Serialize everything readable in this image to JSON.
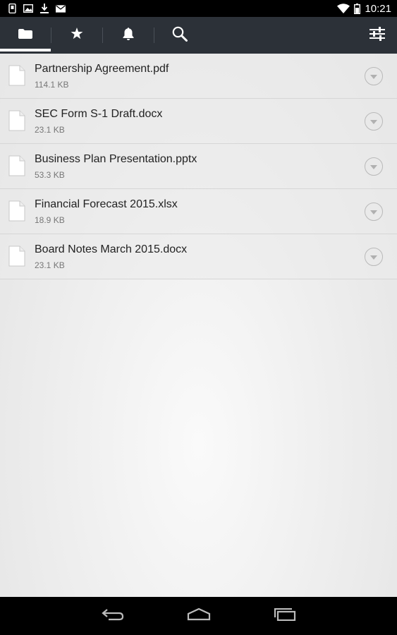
{
  "status_bar": {
    "time": "10:21",
    "left_icons": [
      "phone-storage-icon",
      "image-icon",
      "download-icon",
      "mail-icon"
    ],
    "right_icons": [
      "wifi-icon",
      "battery-icon"
    ]
  },
  "toolbar": {
    "tabs": [
      {
        "name": "folder-icon",
        "active": true
      },
      {
        "name": "star-icon",
        "active": false
      },
      {
        "name": "bell-icon",
        "active": false
      },
      {
        "name": "search-icon",
        "active": false
      }
    ],
    "settings_icon": "sliders-icon",
    "background": "#2c3138"
  },
  "files": [
    {
      "name": "Partnership Agreement.pdf",
      "size": "114.1 KB"
    },
    {
      "name": "SEC Form S-1 Draft.docx",
      "size": "23.1 KB"
    },
    {
      "name": "Business Plan Presentation.pptx",
      "size": "53.3 KB"
    },
    {
      "name": "Financial Forecast 2015.xlsx",
      "size": "18.9 KB"
    },
    {
      "name": "Board Notes March 2015.docx",
      "size": "23.1 KB"
    }
  ],
  "nav_bar": {
    "buttons": [
      "back-icon",
      "home-icon",
      "recent-apps-icon"
    ]
  }
}
